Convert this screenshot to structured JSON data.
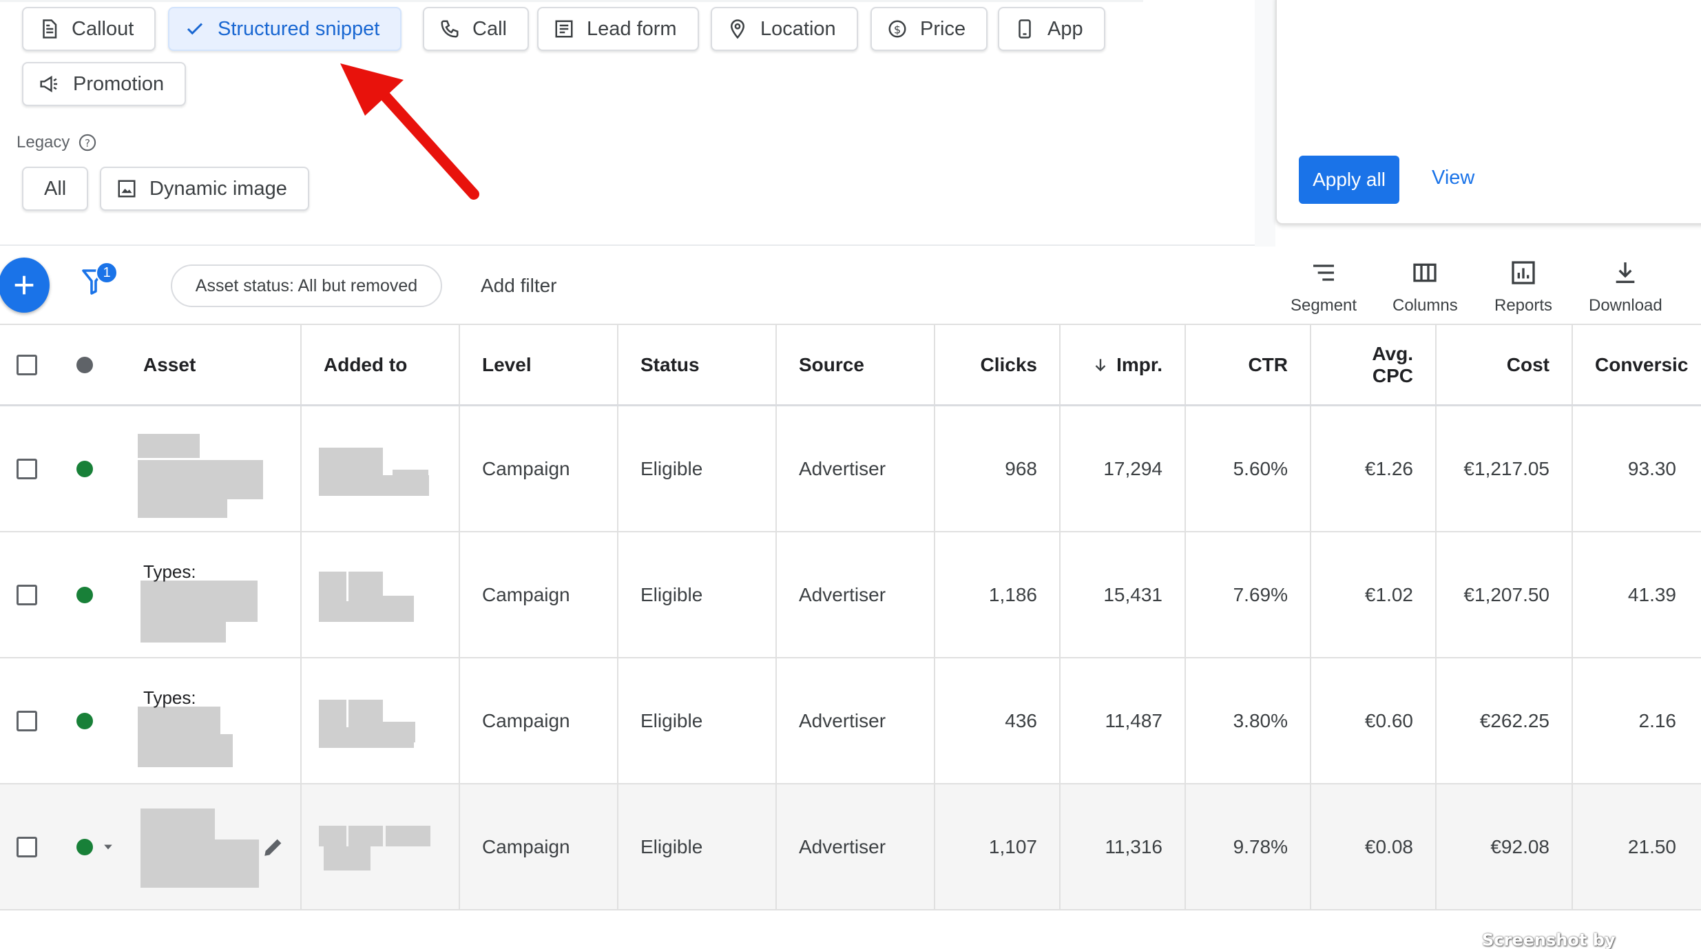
{
  "chips": [
    {
      "label": "Callout",
      "icon": "document-icon"
    },
    {
      "label": "Structured snippet",
      "icon": "checkmark-icon",
      "selected": true
    },
    {
      "label": "Call",
      "icon": "phone-icon"
    },
    {
      "label": "Lead form",
      "icon": "form-icon"
    },
    {
      "label": "Location",
      "icon": "location-pin-icon"
    },
    {
      "label": "Price",
      "icon": "price-icon"
    },
    {
      "label": "App",
      "icon": "phone-device-icon"
    },
    {
      "label": "Promotion",
      "icon": "megaphone-icon"
    }
  ],
  "legacy": {
    "label": "Legacy",
    "chips": [
      {
        "label": "All"
      },
      {
        "label": "Dynamic image",
        "icon": "image-icon"
      }
    ]
  },
  "panel": {
    "apply_label": "Apply all",
    "view_label": "View"
  },
  "toolbar": {
    "filter_count": "1",
    "status_filter": "Asset status: All but removed",
    "add_filter": "Add filter",
    "tools": [
      "Segment",
      "Columns",
      "Reports",
      "Download"
    ]
  },
  "table": {
    "headers": {
      "asset": "Asset",
      "added_to": "Added to",
      "level": "Level",
      "status": "Status",
      "source": "Source",
      "clicks": "Clicks",
      "impr": "Impr.",
      "ctr": "CTR",
      "avg_cpc_1": "Avg.",
      "avg_cpc_2": "CPC",
      "cost": "Cost",
      "conversions": "Conversic"
    },
    "rows": [
      {
        "asset_label": "",
        "level": "Campaign",
        "status": "Eligible",
        "source": "Advertiser",
        "clicks": "968",
        "impr": "17,294",
        "ctr": "5.60%",
        "avg_cpc": "€1.26",
        "cost": "€1,217.05",
        "conversions": "93.30"
      },
      {
        "asset_label": "Types:",
        "level": "Campaign",
        "status": "Eligible",
        "source": "Advertiser",
        "clicks": "1,186",
        "impr": "15,431",
        "ctr": "7.69%",
        "avg_cpc": "€1.02",
        "cost": "€1,207.50",
        "conversions": "41.39"
      },
      {
        "asset_label": "Types:",
        "level": "Campaign",
        "status": "Eligible",
        "source": "Advertiser",
        "clicks": "436",
        "impr": "11,487",
        "ctr": "3.80%",
        "avg_cpc": "€0.60",
        "cost": "€262.25",
        "conversions": "2.16"
      },
      {
        "asset_label": "",
        "level": "Campaign",
        "status": "Eligible",
        "source": "Advertiser",
        "clicks": "1,107",
        "impr": "11,316",
        "ctr": "9.78%",
        "avg_cpc": "€0.08",
        "cost": "€92.08",
        "conversions": "21.50"
      }
    ]
  },
  "colors": {
    "accent": "#1a73e8",
    "eligible": "#188038",
    "arrow": "#e8120c"
  },
  "watermark": "Screenshot by Xnapper.com"
}
